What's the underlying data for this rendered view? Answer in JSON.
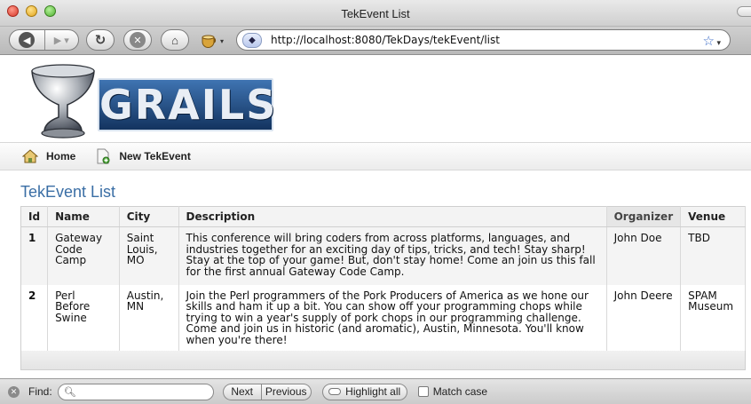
{
  "window": {
    "title": "TekEvent List"
  },
  "toolbar": {
    "back_icon": "back-arrow",
    "forward_icon": "forward-arrow",
    "reload_icon": "reload",
    "stop_icon": "stop-x",
    "home_icon": "home",
    "url": "http://localhost:8080/TekDays/tekEvent/list"
  },
  "logo": {
    "text": "GRAILS"
  },
  "nav": {
    "home_label": "Home",
    "new_label": "New TekEvent"
  },
  "page": {
    "title": "TekEvent List"
  },
  "table": {
    "headers": [
      "Id",
      "Name",
      "City",
      "Description",
      "Organizer",
      "Venue"
    ],
    "rows": [
      {
        "id": "1",
        "name": "Gateway Code Camp",
        "city": "Saint Louis, MO",
        "description": "This conference will bring coders from across platforms, languages, and industries together for an exciting day of tips, tricks, and tech! Stay sharp! Stay at the top of your game! But, don't stay home! Come an join us this fall for the first annual Gateway Code Camp.",
        "organizer": "John Doe",
        "venue": "TBD"
      },
      {
        "id": "2",
        "name": "Perl Before Swine",
        "city": "Austin, MN",
        "description": "Join the Perl programmers of the Pork Producers of America as we hone our skills and ham it up a bit. You can show off your programming chops while trying to win a year's supply of pork chops in our programming challenge. Come and join us in historic (and aromatic), Austin, Minnesota. You'll know when you're there!",
        "organizer": "John Deere",
        "venue": "SPAM Museum"
      }
    ]
  },
  "findbar": {
    "label": "Find:",
    "query": "",
    "next_label": "Next",
    "previous_label": "Previous",
    "highlight_label": "Highlight all",
    "match_case_label": "Match case"
  },
  "colors": {
    "title_blue": "#3a6ea5",
    "logo_blue": "#1f4f8c"
  }
}
